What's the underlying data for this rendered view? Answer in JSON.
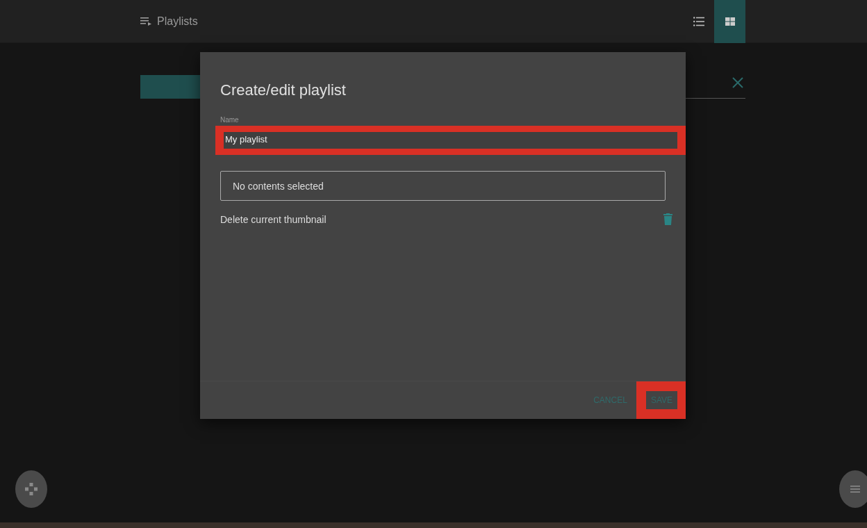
{
  "header": {
    "title": "Playlists",
    "view_buttons": [
      {
        "kind": "list",
        "selected": false
      },
      {
        "kind": "grid",
        "selected": true
      }
    ]
  },
  "dialog": {
    "title": "Create/edit playlist",
    "name_field": {
      "label": "Name",
      "value": "My playlist",
      "highlighted": true
    },
    "contents_field": {
      "value": "No contents selected"
    },
    "thumbnail": {
      "label": "Delete current thumbnail"
    },
    "buttons": [
      {
        "label": "CANCEL",
        "highlighted": false
      },
      {
        "label": "SAVE",
        "highlighted": true
      }
    ]
  }
}
